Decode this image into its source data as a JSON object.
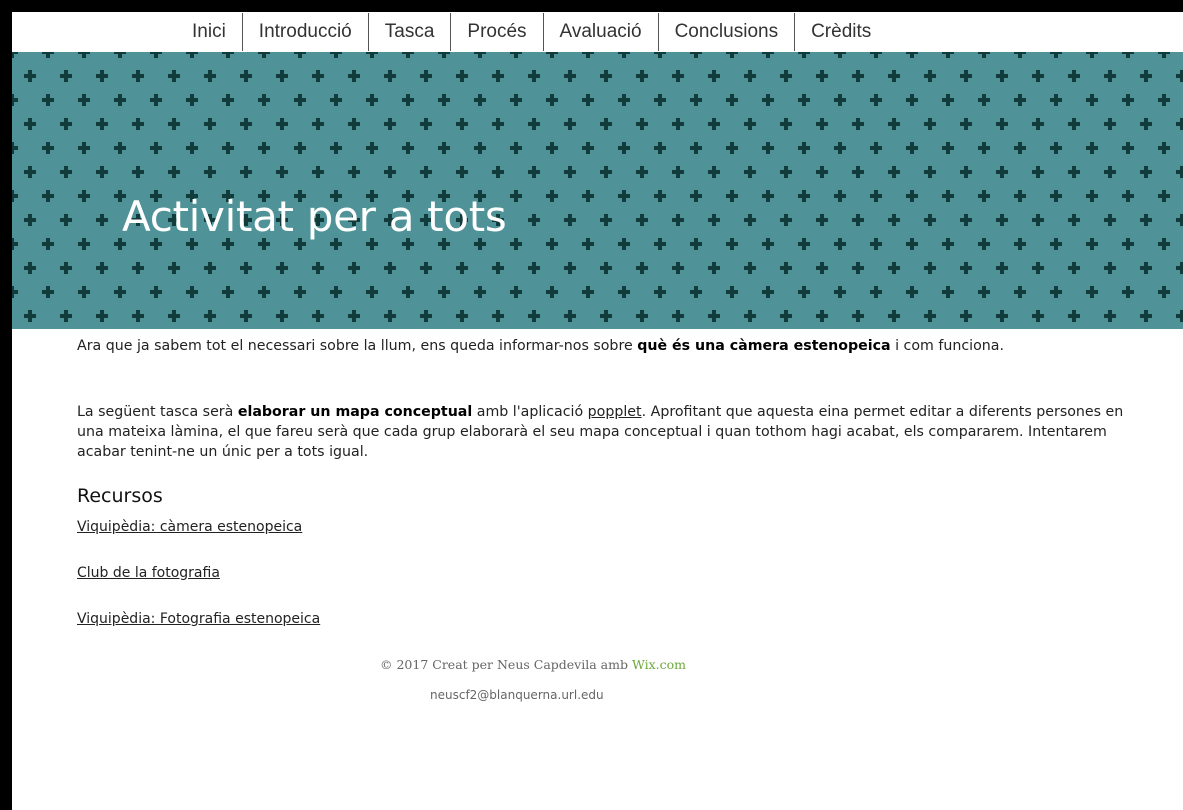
{
  "nav": {
    "items": [
      "Inici",
      "Introducció",
      "Tasca",
      "Procés",
      "Avaluació",
      "Conclusions",
      "Crèdits"
    ]
  },
  "hero": {
    "title": "Activitat per a tots",
    "pattern_color": "#123c3c",
    "background_color": "#4f9297",
    "pattern_icon": "plus-icon"
  },
  "intro": {
    "p1_a": "Ara que ja sabem tot el necessari sobre la llum, ens queda informar-nos sobre ",
    "p1_bold": "què és una càmera estenopeica",
    "p1_b": " i com funciona.",
    "p2_a": "La següent tasca serà ",
    "p2_bold": "elaborar un mapa conceptual",
    "p2_b": " amb l'aplicació ",
    "p2_link": "popplet",
    "p2_c": ". Aprofitant que aquesta eina permet editar a diferents persones en una mateixa làmina, el que fareu serà que cada grup elaborarà el seu mapa conceptual i quan tothom hagi acabat, els compararem. Intentarem acabar tenint-ne un únic per a tots igual."
  },
  "resources": {
    "heading": "Recursos",
    "links": [
      "Viquipèdia: càmera estenopeica",
      "Club de la fotografia",
      "Viquipèdia: Fotografia estenopeica"
    ]
  },
  "footer": {
    "copyright": "© 2017 Creat per Neus Capdevila amb ",
    "wix": "Wix.com",
    "email": "neuscf2@blanquerna.url.edu"
  }
}
